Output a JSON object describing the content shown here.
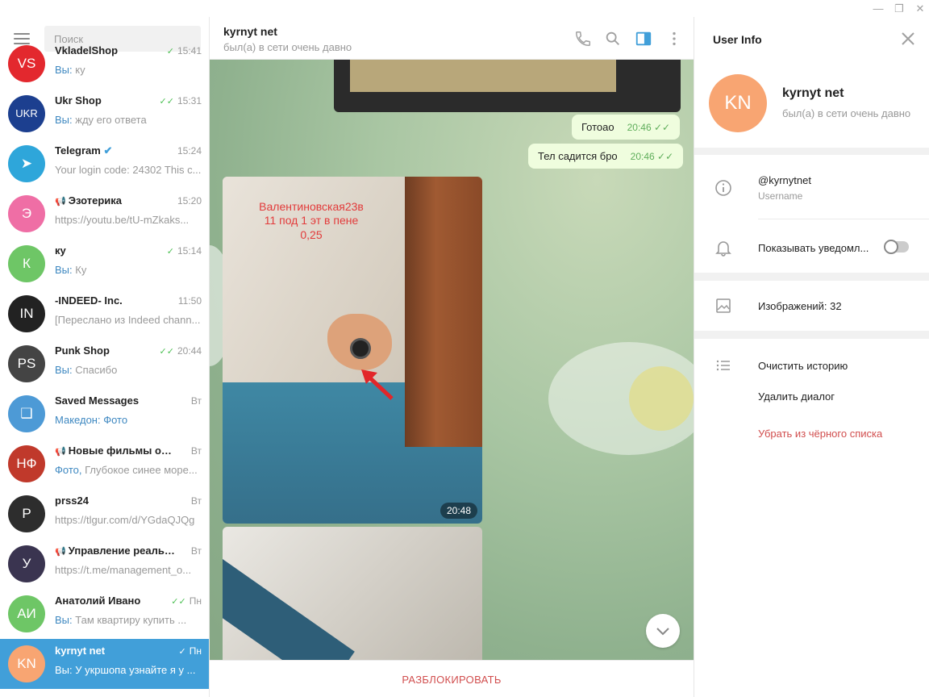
{
  "search": {
    "placeholder": "Поиск"
  },
  "chats": [
    {
      "name": "VkladelShop",
      "time": "15:41",
      "check": "single",
      "prefix": "Вы:",
      "msg": " ку",
      "avatar_text": "VS",
      "avatar_color": "#e3282e"
    },
    {
      "name": "Ukr Shop",
      "time": "15:31",
      "check": "double",
      "prefix": "Вы:",
      "msg": " жду его ответа",
      "avatar_text": "UKR",
      "avatar_color": "#1c3f8f"
    },
    {
      "name": "Telegram",
      "time": "15:24",
      "check": "",
      "prefix": "",
      "msg": "Your login code: 24302  This c...",
      "avatar_text": "➤",
      "avatar_color": "#2ea6da",
      "verified": true
    },
    {
      "name": "Эзотерика",
      "time": "15:20",
      "check": "",
      "prefix": "",
      "msg": "https://youtu.be/tU-mZkaks...",
      "avatar_text": "Э",
      "avatar_color": "#ef6ea5",
      "channel": true
    },
    {
      "name": "ку",
      "time": "15:14",
      "check": "single",
      "prefix": "Вы:",
      "msg": " Ку",
      "avatar_text": "К",
      "avatar_color": "#6ec666"
    },
    {
      "name": "-INDEED- Inc.",
      "time": "11:50",
      "check": "",
      "prefix": "",
      "msg": "[Переслано из Indeed chann...",
      "avatar_text": "IN",
      "avatar_color": "#222222"
    },
    {
      "name": "Punk Shop",
      "time": "20:44",
      "check": "double",
      "prefix": "Вы:",
      "msg": " Спасибо",
      "avatar_text": "PS",
      "avatar_color": "#444444"
    },
    {
      "name": "Saved Messages",
      "time": "Вт",
      "check": "",
      "prefix": "Македон: Фото",
      "msg": "",
      "avatar_text": "❑",
      "avatar_color": "#4d9ad6"
    },
    {
      "name": "Новые фильмы он...",
      "time": "Вт",
      "check": "",
      "prefix": "Фото,",
      "msg": " Глубокое синее море...",
      "avatar_text": "НФ",
      "avatar_color": "#c0392b",
      "channel": true
    },
    {
      "name": "prss24",
      "time": "Вт",
      "check": "",
      "prefix": "",
      "msg": "https://tlgur.com/d/YGdaQJQg",
      "avatar_text": "P",
      "avatar_color": "#2d2d2d"
    },
    {
      "name": "Управление реальн...",
      "time": "Вт",
      "check": "",
      "prefix": "",
      "msg": "https://t.me/management_o...",
      "avatar_text": "У",
      "avatar_color": "#3a3450",
      "channel": true
    },
    {
      "name": "Анатолий Ивано",
      "time": "Пн",
      "check": "double",
      "prefix": "Вы:",
      "msg": " Там квартиру купить ...",
      "avatar_text": "АИ",
      "avatar_color": "#6ec666"
    },
    {
      "name": "kyrnyt net",
      "time": "Пн",
      "check": "single",
      "prefix": "",
      "msg": "Вы: У укршопа узнайте я у ...",
      "avatar_text": "KN",
      "avatar_color": "#f8a572",
      "active": true
    }
  ],
  "header": {
    "name": "kyrnyt net",
    "status": "был(а) в сети очень давно"
  },
  "messages": [
    {
      "text": "Готоао",
      "time": "20:46"
    },
    {
      "text": "Тел садится бро",
      "time": "20:46"
    }
  ],
  "photo": {
    "line1": "Валентиновская23в",
    "line2": "11 под 1 эт в пене",
    "line3": "0,25",
    "time": "20:48"
  },
  "unblock_label": "РАЗБЛОКИРОВАТЬ",
  "info": {
    "title": "User Info",
    "avatar_text": "KN",
    "name": "kyrnyt net",
    "status": "был(а) в сети очень давно",
    "username": "@kyrnytnet",
    "username_label": "Username",
    "notifications_label": "Показывать уведомл...",
    "notifications_on": false,
    "images_label": "Изображений: 32",
    "clear_history": "Очистить историю",
    "delete_dialog": "Удалить диалог",
    "unblacklist": "Убрать из чёрного списка"
  },
  "colors": {
    "accent": "#419fd9",
    "danger": "#d14e4e",
    "bubble": "#effdde"
  }
}
